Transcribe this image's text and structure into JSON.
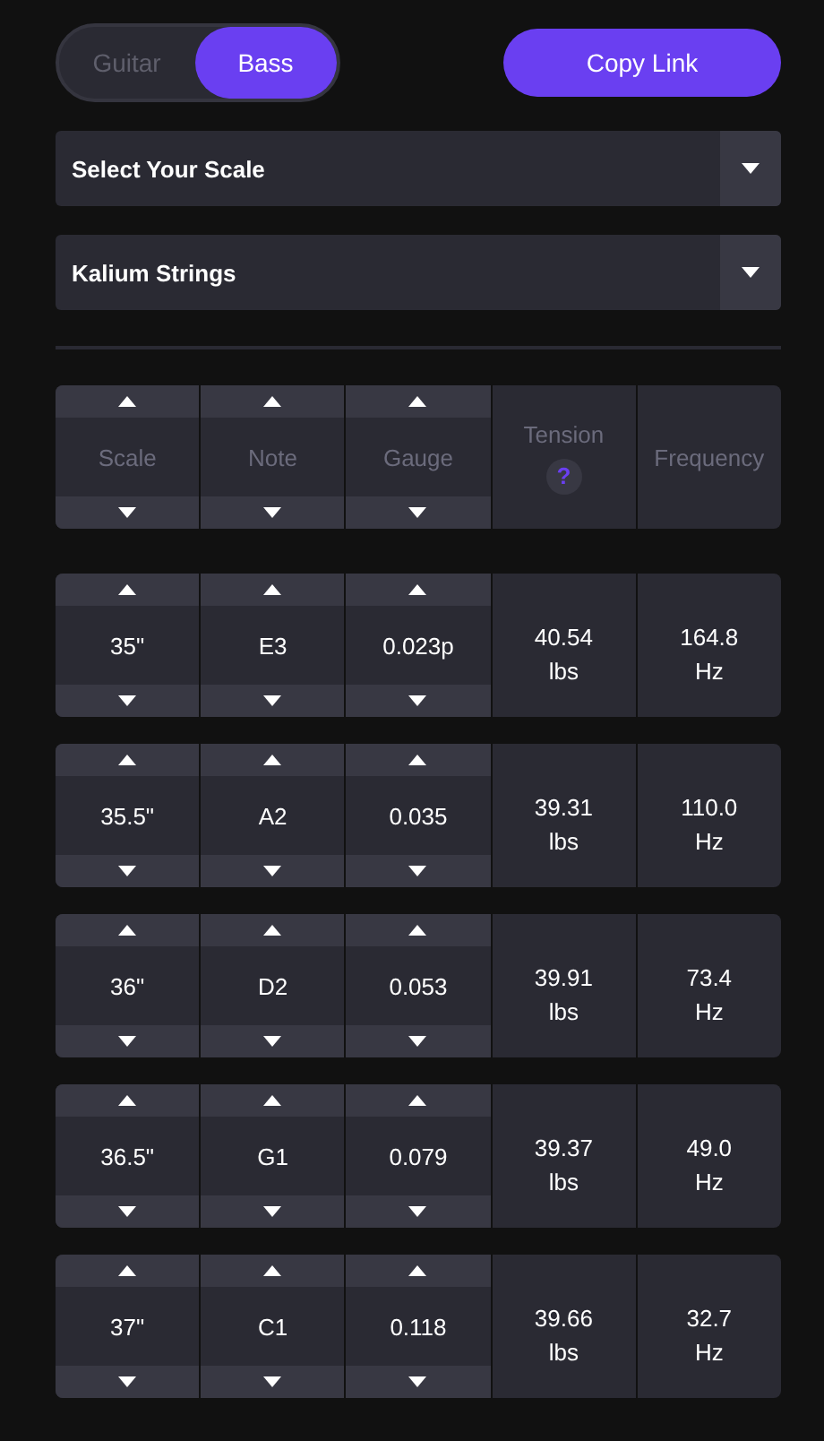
{
  "instrument_toggle": [
    {
      "label": "Guitar",
      "selected": false
    },
    {
      "label": "Bass",
      "selected": true
    }
  ],
  "copy_button": "Copy Link",
  "selects": [
    {
      "value": "Select Your Scale"
    },
    {
      "value": "Kalium Strings"
    }
  ],
  "columns": [
    {
      "label": "Scale",
      "kind": "stepper"
    },
    {
      "label": "Note",
      "kind": "stepper"
    },
    {
      "label": "Gauge",
      "kind": "stepper"
    },
    {
      "label": "Tension",
      "kind": "readout",
      "help": "?"
    },
    {
      "label": "Frequency",
      "kind": "readout"
    }
  ],
  "rows": [
    {
      "cells": [
        "35\"",
        "E3",
        "0.023p",
        [
          "40.54",
          "lbs"
        ],
        [
          "164.8",
          "Hz"
        ]
      ]
    },
    {
      "cells": [
        "35.5\"",
        "A2",
        "0.035",
        [
          "39.31",
          "lbs"
        ],
        [
          "110.0",
          "Hz"
        ]
      ]
    },
    {
      "cells": [
        "36\"",
        "D2",
        "0.053",
        [
          "39.91",
          "lbs"
        ],
        [
          "73.4",
          "Hz"
        ]
      ]
    },
    {
      "cells": [
        "36.5\"",
        "G1",
        "0.079",
        [
          "39.37",
          "lbs"
        ],
        [
          "49.0",
          "Hz"
        ]
      ]
    },
    {
      "cells": [
        "37\"",
        "C1",
        "0.118",
        [
          "39.66",
          "lbs"
        ],
        [
          "32.7",
          "Hz"
        ]
      ]
    }
  ]
}
